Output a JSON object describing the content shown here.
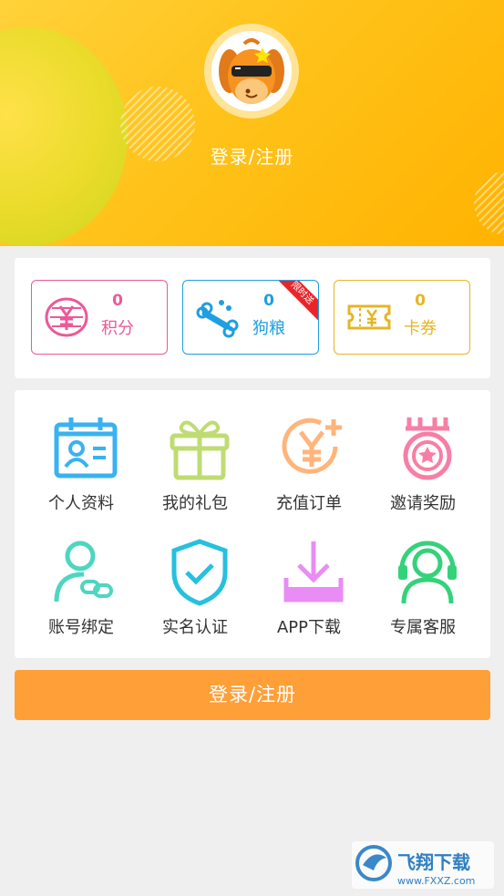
{
  "header": {
    "login_label": "登录/注册"
  },
  "stats": [
    {
      "value": "0",
      "label": "积分",
      "color": "#ea5a99",
      "icon": "yen-coins-icon"
    },
    {
      "value": "0",
      "label": "狗粮",
      "color": "#1e9fe0",
      "icon": "bone-icon",
      "badge": "限时送"
    },
    {
      "value": "0",
      "label": "卡券",
      "color": "#e6b524",
      "icon": "coupon-ticket-icon"
    }
  ],
  "menu": [
    {
      "label": "个人资料",
      "icon": "profile-card-icon",
      "color": "#3ab2f2"
    },
    {
      "label": "我的礼包",
      "icon": "gift-icon",
      "color": "#bfdc72"
    },
    {
      "label": "充值订单",
      "icon": "recharge-yen-icon",
      "color": "#ffb47a"
    },
    {
      "label": "邀请奖励",
      "icon": "medal-icon",
      "color": "#f77ea5"
    },
    {
      "label": "账号绑定",
      "icon": "user-link-icon",
      "color": "#4dd6c0"
    },
    {
      "label": "实名认证",
      "icon": "shield-check-icon",
      "color": "#27c0df"
    },
    {
      "label": "APP下载",
      "icon": "download-icon",
      "color": "#ea8cf5"
    },
    {
      "label": "专属客服",
      "icon": "customer-service-icon",
      "color": "#34d27a"
    }
  ],
  "login_button": {
    "label": "登录/注册"
  },
  "watermark": {
    "brand": "飞翔下载",
    "url": "www.FXXZ.com"
  },
  "colors": {
    "header_yellow": "#ffc21a",
    "button_orange": "#ff9f38",
    "page_bg": "#efefef"
  }
}
